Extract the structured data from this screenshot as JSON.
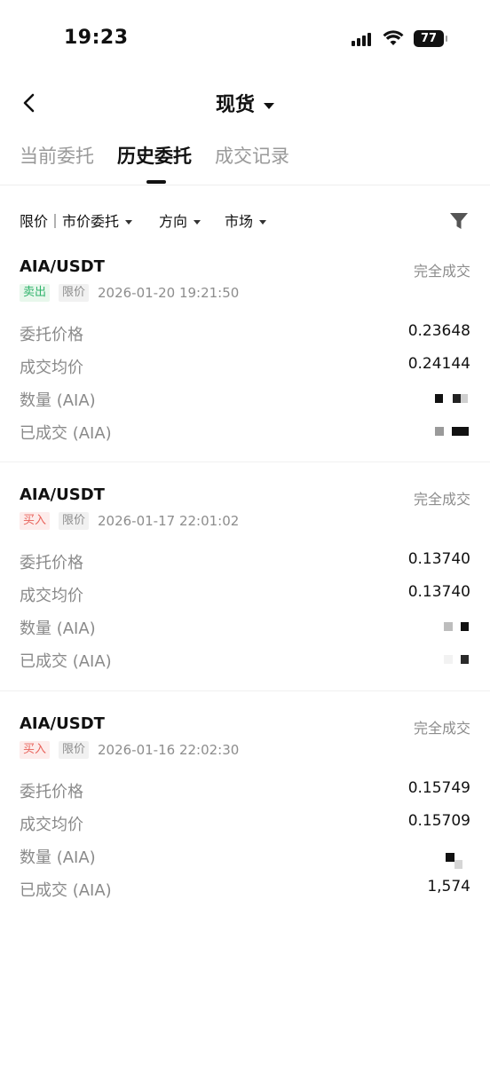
{
  "status_bar": {
    "time": "19:23",
    "battery": "77",
    "icons": [
      "signal-icon",
      "wifi-icon",
      "battery-icon"
    ]
  },
  "header": {
    "title": "现货",
    "back_icon": "chevron-left-icon",
    "title_caret_icon": "caret-down-icon"
  },
  "tabs": [
    {
      "label": "当前委托",
      "active": false
    },
    {
      "label": "历史委托",
      "active": true
    },
    {
      "label": "成交记录",
      "active": false
    }
  ],
  "filters": [
    {
      "label": "限价｜市价委托"
    },
    {
      "label": "方向"
    },
    {
      "label": "市场"
    }
  ],
  "filter_icon": "funnel-icon",
  "orders": [
    {
      "pair": "AIA/USDT",
      "status": "完全成交",
      "side": "卖出",
      "type": "限价",
      "time": "2026-01-20 19:21:50",
      "rows": [
        {
          "label": "委托价格",
          "value": "0.23648"
        },
        {
          "label": "成交均价",
          "value": "0.24144"
        },
        {
          "label": "数量 (AIA)",
          "value": ""
        },
        {
          "label": "已成交 (AIA)",
          "value": ""
        }
      ]
    },
    {
      "pair": "AIA/USDT",
      "status": "完全成交",
      "side": "买入",
      "type": "限价",
      "time": "2026-01-17 22:01:02",
      "rows": [
        {
          "label": "委托价格",
          "value": "0.13740"
        },
        {
          "label": "成交均价",
          "value": "0.13740"
        },
        {
          "label": "数量 (AIA)",
          "value": ""
        },
        {
          "label": "已成交 (AIA)",
          "value": ""
        }
      ]
    },
    {
      "pair": "AIA/USDT",
      "status": "完全成交",
      "side": "买入",
      "type": "限价",
      "time": "2026-01-16 22:02:30",
      "rows": [
        {
          "label": "委托价格",
          "value": "0.15749"
        },
        {
          "label": "成交均价",
          "value": "0.15709"
        },
        {
          "label": "数量 (AIA)",
          "value": ""
        },
        {
          "label": "已成交 (AIA)",
          "value": "1,574"
        }
      ]
    }
  ],
  "colors": {
    "sell": "#2fb36b",
    "buy": "#e8625a",
    "muted": "#8d8d8d"
  }
}
